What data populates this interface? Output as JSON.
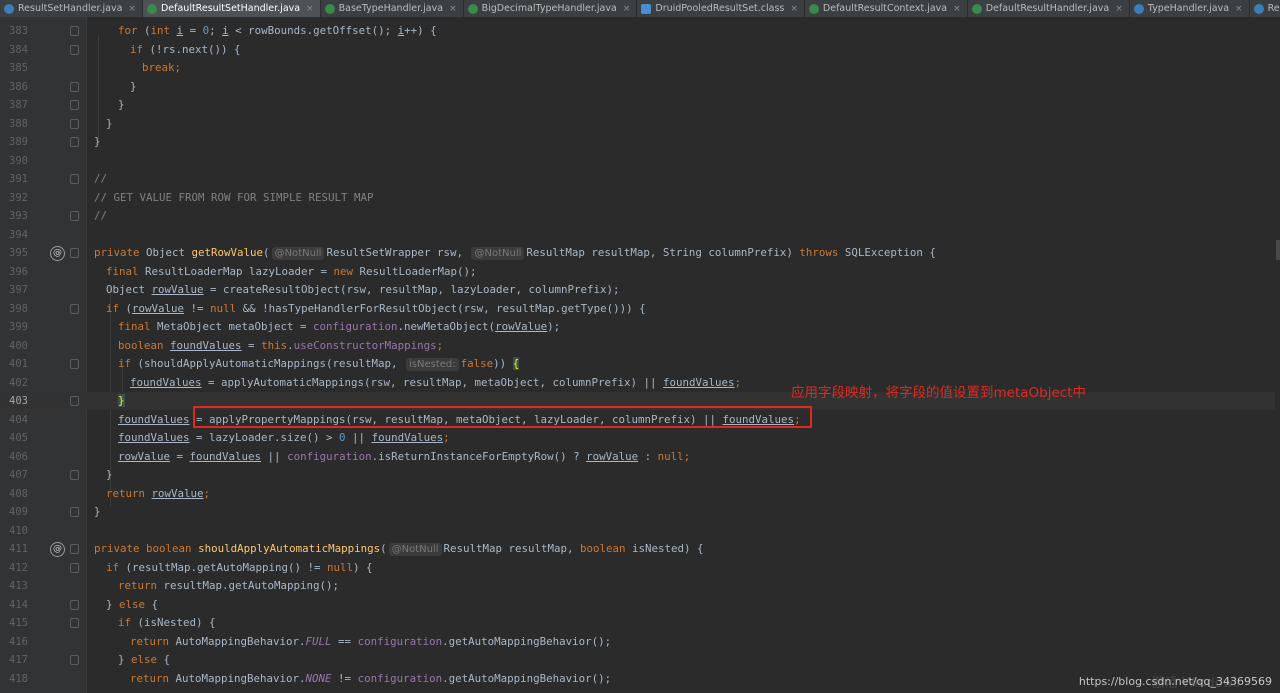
{
  "tabs": [
    {
      "label": "ResultSetHandler.java",
      "icon": "interface-icon",
      "active": false
    },
    {
      "label": "DefaultResultSetHandler.java",
      "icon": "class-icon",
      "active": true
    },
    {
      "label": "BaseTypeHandler.java",
      "icon": "class-icon",
      "active": false
    },
    {
      "label": "BigDecimalTypeHandler.java",
      "icon": "class-icon",
      "active": false
    },
    {
      "label": "DruidPooledResultSet.class",
      "icon": "compiled-class-icon",
      "active": false
    },
    {
      "label": "DefaultResultContext.java",
      "icon": "class-icon",
      "active": false
    },
    {
      "label": "DefaultResultHandler.java",
      "icon": "class-icon",
      "active": false
    },
    {
      "label": "TypeHandler.java",
      "icon": "interface-icon",
      "active": false
    },
    {
      "label": "ResultSet.java",
      "icon": "interface-icon",
      "active": false
    }
  ],
  "lines": [
    {
      "n": "383"
    },
    {
      "n": "384"
    },
    {
      "n": "385"
    },
    {
      "n": "386"
    },
    {
      "n": "387"
    },
    {
      "n": "388"
    },
    {
      "n": "389"
    },
    {
      "n": "390"
    },
    {
      "n": "391"
    },
    {
      "n": "392"
    },
    {
      "n": "393"
    },
    {
      "n": "394"
    },
    {
      "n": "395"
    },
    {
      "n": "396"
    },
    {
      "n": "397"
    },
    {
      "n": "398"
    },
    {
      "n": "399"
    },
    {
      "n": "400"
    },
    {
      "n": "401"
    },
    {
      "n": "402"
    },
    {
      "n": "403"
    },
    {
      "n": "404"
    },
    {
      "n": "405"
    },
    {
      "n": "406"
    },
    {
      "n": "407"
    },
    {
      "n": "408"
    },
    {
      "n": "409"
    },
    {
      "n": "410"
    },
    {
      "n": "411"
    },
    {
      "n": "412"
    },
    {
      "n": "413"
    },
    {
      "n": "414"
    },
    {
      "n": "415"
    },
    {
      "n": "416"
    },
    {
      "n": "417"
    },
    {
      "n": "418"
    }
  ],
  "code": {
    "l383": {
      "a": "for",
      "b": " (",
      "c": "int",
      "d": " ",
      "e": "i",
      "f": " = ",
      "g": "0",
      "h": "; ",
      "i": "i",
      "j": " < rowBounds.getOffset(); ",
      "k": "i",
      "l": "++) {"
    },
    "l384": {
      "a": "if",
      "b": " (!rs.next()) {"
    },
    "l385": {
      "a": "break",
      "b": ";"
    },
    "l386": {
      "a": "}"
    },
    "l387": {
      "a": "}"
    },
    "l388": {
      "a": "}"
    },
    "l389": {
      "a": "}"
    },
    "l391": {
      "a": "//"
    },
    "l392": {
      "a": "// GET VALUE FROM ROW FOR SIMPLE RESULT MAP"
    },
    "l393": {
      "a": "//"
    },
    "l395": {
      "a": "private",
      "b": " Object ",
      "c": "getRowValue",
      "d": "(",
      "hint1": "@NotNull",
      "e": "ResultSetWrapper rsw, ",
      "hint2": "@NotNull",
      "f": "ResultMap resultMap, String columnPrefix) ",
      "g": "throws",
      "h": " SQLException {"
    },
    "l396": {
      "a": "final",
      "b": " ResultLoaderMap lazyLoader = ",
      "c": "new",
      "d": " ResultLoaderMap();"
    },
    "l397": {
      "a": "Object ",
      "b": "rowValue",
      "c": " = createResultObject(rsw, resultMap, lazyLoader, columnPrefix);"
    },
    "l398": {
      "a": "if",
      "b": " (",
      "c": "rowValue",
      "d": " != ",
      "e": "null",
      "f": " && !hasTypeHandlerForResultObject(rsw, resultMap.getType())) {"
    },
    "l399": {
      "a": "final",
      "b": " MetaObject metaObject = ",
      "c": "configuration",
      "d": ".newMetaObject(",
      "e": "rowValue",
      "f": ");"
    },
    "l400": {
      "a": "boolean",
      "b": " ",
      "c": "foundValues",
      "d": " = ",
      "e": "this",
      "f": ".",
      "g": "useConstructorMappings",
      "h": ";"
    },
    "l401": {
      "a": "if",
      "b": " (shouldApplyAutomaticMappings(resultMap, ",
      "hint": "isNested:",
      "c": "false",
      "d": ")) ",
      "e": "{"
    },
    "l402": {
      "a": "foundValues",
      "b": " = applyAutomaticMappings(rsw, resultMap, metaObject, columnPrefix) || ",
      "c": "foundValues",
      "d": ";"
    },
    "l403": {
      "a": "}"
    },
    "l404": {
      "a": "foundValues",
      "b": " = applyPropertyMappings(rsw, resultMap, metaObject, lazyLoader, columnPrefix) || ",
      "c": "foundValues",
      "d": ";"
    },
    "l405": {
      "a": "foundValues",
      "b": " = lazyLoader.size() > ",
      "c": "0",
      "d": " || ",
      "e": "foundValues",
      "f": ";"
    },
    "l406": {
      "a": "rowValue",
      "b": " = ",
      "c": "foundValues",
      "d": " || ",
      "e": "configuration",
      "f": ".isReturnInstanceForEmptyRow() ? ",
      "g": "rowValue",
      "h": " : ",
      "i": "null",
      "j": ";"
    },
    "l407": {
      "a": "}"
    },
    "l408": {
      "a": "return",
      "b": " ",
      "c": "rowValue",
      "d": ";"
    },
    "l409": {
      "a": "}"
    },
    "l411": {
      "a": "private",
      "b": " ",
      "c": "boolean",
      "d": " ",
      "e": "shouldApplyAutomaticMappings",
      "f": "(",
      "hint": "@NotNull",
      "g": "ResultMap resultMap, ",
      "h": "boolean",
      "i": " isNested) {"
    },
    "l412": {
      "a": "if",
      "b": " (resultMap.getAutoMapping() != ",
      "c": "null",
      "d": ") {"
    },
    "l413": {
      "a": "return",
      "b": " resultMap.getAutoMapping();"
    },
    "l414": {
      "a": "} ",
      "b": "else",
      "c": " {"
    },
    "l415": {
      "a": "if",
      "b": " (isNested) {"
    },
    "l416": {
      "a": "return",
      "b": " AutoMappingBehavior.",
      "c": "FULL",
      "d": " == ",
      "e": "configuration",
      "f": ".getAutoMappingBehavior();"
    },
    "l417": {
      "a": "} ",
      "b": "else",
      "c": " {"
    },
    "l418": {
      "a": "return",
      "b": " AutoMappingBehavior.",
      "c": "NONE",
      "d": " != ",
      "e": "configuration",
      "f": ".getAutoMappingBehavior();"
    }
  },
  "gutter_marks": {
    "l395": "@",
    "l411": "@"
  },
  "annotation": {
    "text": "应用字段映射，将字段的值设置到metaObject中",
    "color": "#e0291e"
  },
  "watermark": {
    "text": "https://blog.csdn.net/qq_34369569",
    "background_text": "激活 Windows"
  },
  "colors": {
    "background": "#2b2b2b",
    "keyword": "#cc7832",
    "method": "#ffc66d",
    "field": "#9876aa",
    "comment": "#808080",
    "number": "#6897bb",
    "text": "#a9b7c6"
  }
}
